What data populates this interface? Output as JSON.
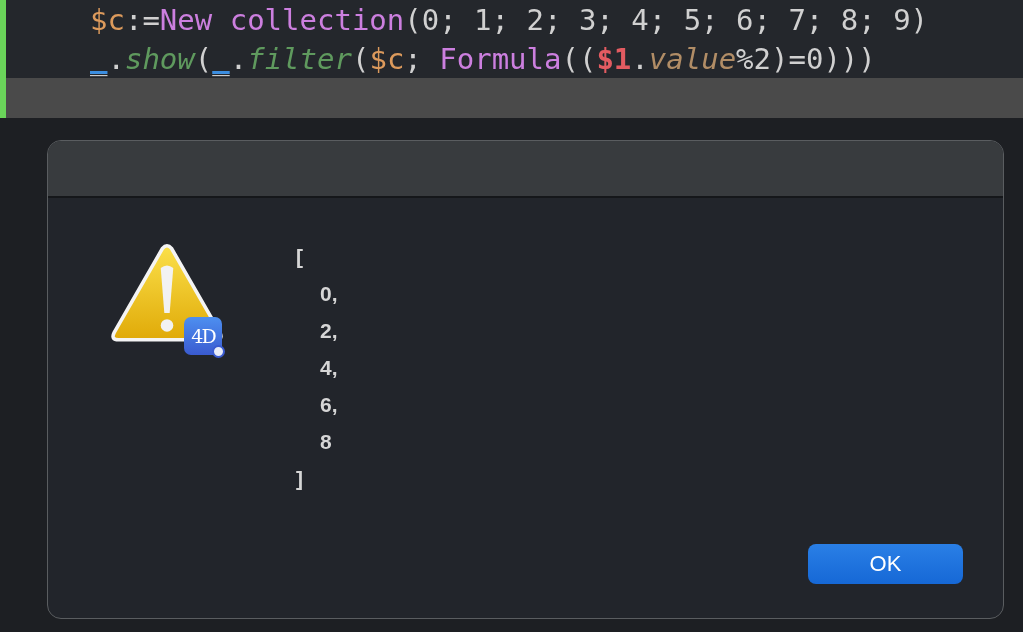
{
  "editor": {
    "lines": [
      {
        "current": false,
        "tokens": [
          {
            "kind": "variable",
            "text": "$c"
          },
          {
            "kind": "plain",
            "text": ":="
          },
          {
            "kind": "keyword",
            "text": "New collection"
          },
          {
            "kind": "plain",
            "text": "(0; 1; 2; 3; 4; 5; 6; 7; 8; 9)"
          }
        ]
      },
      {
        "current": false,
        "tokens": [
          {
            "kind": "object",
            "text": "_"
          },
          {
            "kind": "plain",
            "text": "."
          },
          {
            "kind": "method",
            "text": "show"
          },
          {
            "kind": "plain",
            "text": "("
          },
          {
            "kind": "object",
            "text": "_"
          },
          {
            "kind": "plain",
            "text": "."
          },
          {
            "kind": "method",
            "text": "filter"
          },
          {
            "kind": "plain",
            "text": "("
          },
          {
            "kind": "variable",
            "text": "$c"
          },
          {
            "kind": "plain",
            "text": "; "
          },
          {
            "kind": "keyword",
            "text": "Formula"
          },
          {
            "kind": "plain",
            "text": "(("
          },
          {
            "kind": "parameter",
            "text": "$1"
          },
          {
            "kind": "plain",
            "text": "."
          },
          {
            "kind": "property",
            "text": "value"
          },
          {
            "kind": "plain",
            "text": "%2)=0)))"
          }
        ]
      },
      {
        "current": true
      }
    ]
  },
  "dialog": {
    "icon_badge": "4D",
    "message": [
      {
        "kind": "bracket",
        "text": "["
      },
      {
        "kind": "item",
        "text": "0,"
      },
      {
        "kind": "item",
        "text": "2,"
      },
      {
        "kind": "item",
        "text": "4,"
      },
      {
        "kind": "item",
        "text": "6,"
      },
      {
        "kind": "item",
        "text": "8"
      },
      {
        "kind": "bracket",
        "text": "]"
      }
    ],
    "buttons": [
      "OK"
    ]
  }
}
